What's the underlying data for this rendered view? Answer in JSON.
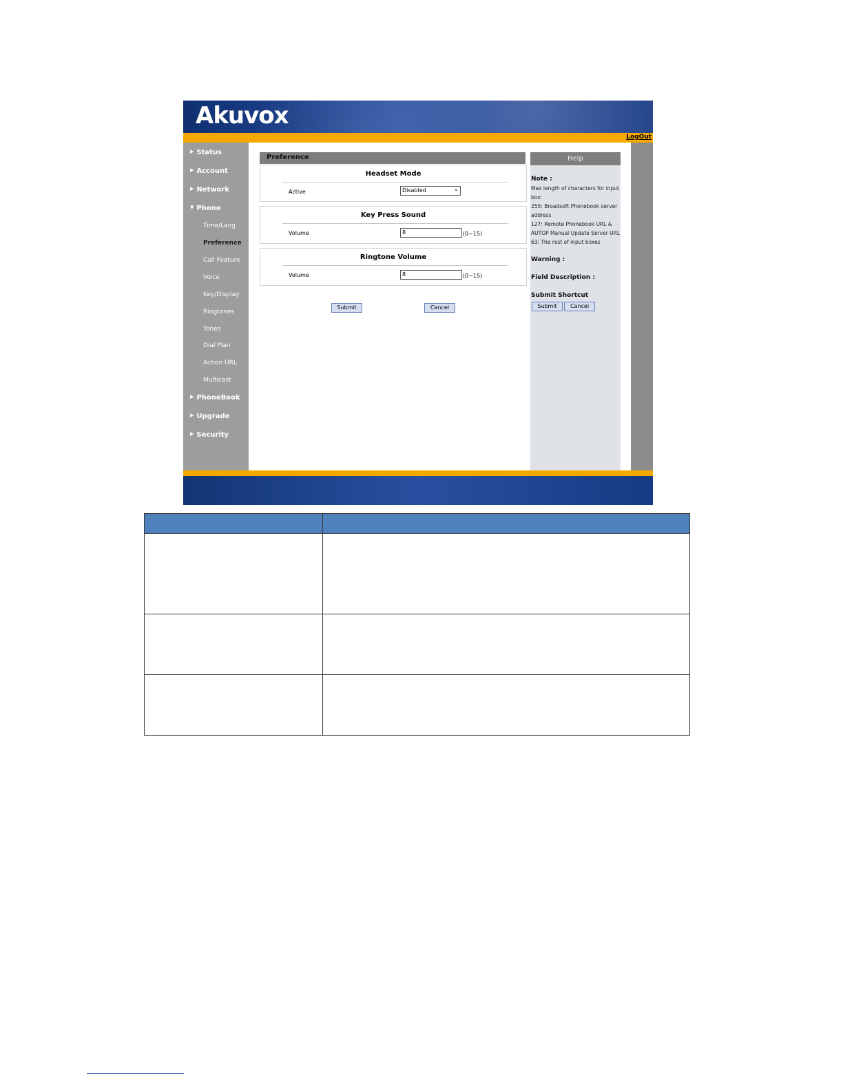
{
  "brand": {
    "logo_text": "Akuvox"
  },
  "header": {
    "logout_label": "LogOut"
  },
  "sidebar": {
    "items": [
      {
        "label": "Status",
        "expanded": false
      },
      {
        "label": "Account",
        "expanded": false
      },
      {
        "label": "Network",
        "expanded": false
      },
      {
        "label": "Phone",
        "expanded": true
      },
      {
        "label": "PhoneBook",
        "expanded": false
      },
      {
        "label": "Upgrade",
        "expanded": false
      },
      {
        "label": "Security",
        "expanded": false
      }
    ],
    "phone_subitems": [
      {
        "label": "Time/Lang"
      },
      {
        "label": "Preference",
        "active": true
      },
      {
        "label": "Call Feature"
      },
      {
        "label": "Voice"
      },
      {
        "label": "Key/Display"
      },
      {
        "label": "Ringtones"
      },
      {
        "label": "Tones"
      },
      {
        "label": "Dial Plan"
      },
      {
        "label": "Action URL"
      },
      {
        "label": "Multicast"
      }
    ]
  },
  "main": {
    "title": "Preference",
    "sections": [
      {
        "title": "Headset Mode",
        "field_label": "Active",
        "value": "Disabled"
      },
      {
        "title": "Key Press Sound",
        "field_label": "Volume",
        "value": "8",
        "range": "(0~15)"
      },
      {
        "title": "Ringtone Volume",
        "field_label": "Volume",
        "value": "8",
        "range": "(0~15)"
      }
    ],
    "submit_label": "Submit",
    "cancel_label": "Cancel"
  },
  "help": {
    "title": "Help",
    "note_label": "Note :",
    "note_lines": [
      "Max length of characters for input box:",
      "255: Broadsoft Phonebook server address",
      "127: Remote Phonebook URL & AUTOP Manual Update Server URL",
      "63: The rest of input boxes"
    ],
    "warning_label": "Warning :",
    "field_description_label": "Field Description :",
    "submit_shortcut_label": "Submit Shortcut",
    "submit_label": "Submit",
    "cancel_label": "Cancel"
  },
  "colors": {
    "banner_blue": "#1f4592",
    "accent_orange": "#f5a800",
    "table_header_blue": "#4f81bd"
  }
}
